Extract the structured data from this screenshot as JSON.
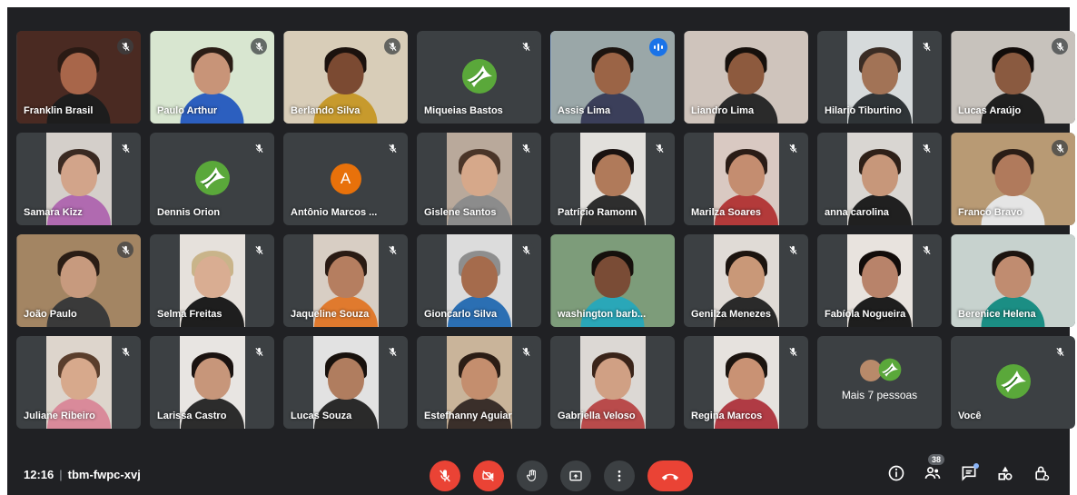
{
  "meeting": {
    "time": "12:16",
    "separator": "|",
    "code": "tbm-fwpc-xvj"
  },
  "participants": [
    {
      "name": "Franklin Brasil",
      "muted": true,
      "style": "photo",
      "bg": "#4a2a22",
      "skin": "#a8664a",
      "shirt": "#1d1d1d",
      "hair": "#2a1a14",
      "wide": true
    },
    {
      "name": "Paulo Arthur",
      "muted": true,
      "style": "photo",
      "bg": "#d8e6d0",
      "skin": "#c89478",
      "shirt": "#2c5fbf",
      "hair": "#2b1d16",
      "wide": true
    },
    {
      "name": "Berlando Silva",
      "muted": true,
      "style": "photo",
      "bg": "#d8cdb8",
      "skin": "#7b4a32",
      "shirt": "#c79a2d",
      "hair": "#1b120e",
      "wide": true
    },
    {
      "name": "Miqueias Bastos",
      "muted": true,
      "style": "logo"
    },
    {
      "name": "Assis Lima",
      "muted": false,
      "speaking": true,
      "style": "photo",
      "bg": "#9aa7a8",
      "skin": "#9b6446",
      "shirt": "#3b3f5a",
      "hair": "#1c1410",
      "wide": true
    },
    {
      "name": "Liandro Lima",
      "muted": false,
      "style": "photo",
      "bg": "#cfc4bc",
      "skin": "#8d5a3e",
      "shirt": "#2a2a2a",
      "hair": "#16100c",
      "wide": true
    },
    {
      "name": "Hilario Tiburtino",
      "muted": true,
      "style": "photo",
      "bg": "#d6dadb",
      "skin": "#a27356",
      "shirt": "#2f3437",
      "hair": "#3a2c24"
    },
    {
      "name": "Lucas Araújo",
      "muted": true,
      "style": "photo",
      "bg": "#c7c2bc",
      "skin": "#8a5a40",
      "shirt": "#1f1f1f",
      "hair": "#120c0a",
      "wide": true
    },
    {
      "name": "Samara Kizz",
      "muted": true,
      "style": "photo",
      "bg": "#d4cfca",
      "skin": "#d2a48a",
      "shirt": "#b06ab0",
      "hair": "#3a2a22"
    },
    {
      "name": "Dennis Orion",
      "muted": true,
      "style": "logo"
    },
    {
      "name": "Antônio Marcos ...",
      "muted": true,
      "style": "letter",
      "letter": "A"
    },
    {
      "name": "Gislene Santos",
      "muted": true,
      "style": "photo",
      "bg": "#b9a99b",
      "skin": "#d6a88a",
      "shirt": "#8c8c8c",
      "hair": "#4a3528"
    },
    {
      "name": "Patrício Ramonn",
      "muted": true,
      "style": "photo",
      "bg": "#e2e0dc",
      "skin": "#b07a5a",
      "shirt": "#2e2e2e",
      "hair": "#1a1210"
    },
    {
      "name": "Marilza Soares",
      "muted": true,
      "style": "photo",
      "bg": "#d9c9c2",
      "skin": "#c48d70",
      "shirt": "#b33a3a",
      "hair": "#2a1c16"
    },
    {
      "name": "anna carolina",
      "muted": true,
      "style": "photo",
      "bg": "#d9d6d2",
      "skin": "#c7977a",
      "shirt": "#202020",
      "hair": "#2e2018"
    },
    {
      "name": "Franco Bravo",
      "muted": true,
      "style": "photo",
      "bg": "#b89a74",
      "skin": "#b07a5c",
      "shirt": "#e5e5e5",
      "hair": "#2a1d16",
      "wide": true
    },
    {
      "name": "João Paulo",
      "muted": true,
      "style": "photo",
      "bg": "#a38563",
      "skin": "#c79a7e",
      "shirt": "#3a3a3a",
      "hair": "#2a1d15",
      "wide": true
    },
    {
      "name": "Selma Freitas",
      "muted": true,
      "style": "photo",
      "bg": "#e6e1dc",
      "skin": "#d9ad92",
      "shirt": "#1e1e1e",
      "hair": "#c9b48a"
    },
    {
      "name": "Jaqueline Souza",
      "muted": true,
      "style": "photo",
      "bg": "#d8cec4",
      "skin": "#b57e60",
      "shirt": "#e07a2e",
      "hair": "#2a1b14"
    },
    {
      "name": "Gioncarlo Silva",
      "muted": true,
      "style": "photo",
      "bg": "#dcdcdc",
      "skin": "#a56b4c",
      "shirt": "#2b6fb3",
      "hair": "#8e8e8e"
    },
    {
      "name": "washington barb...",
      "muted": false,
      "style": "photo",
      "bg": "#7d9c7a",
      "skin": "#7a4c36",
      "shirt": "#2aa7b8",
      "hair": "#15100c",
      "wide": true
    },
    {
      "name": "Genilza Menezes",
      "muted": true,
      "style": "photo",
      "bg": "#e0dbd6",
      "skin": "#c99878",
      "shirt": "#2a2a2a",
      "hair": "#1c140f"
    },
    {
      "name": "Fabíola Nogueira",
      "muted": true,
      "style": "photo",
      "bg": "#e8e3de",
      "skin": "#b8836a",
      "shirt": "#1e1e1e",
      "hair": "#120c0a"
    },
    {
      "name": "Berenice Helena",
      "muted": false,
      "style": "photo",
      "bg": "#c7d2ce",
      "skin": "#c08c70",
      "shirt": "#1b8e84",
      "hair": "#1c140f",
      "wide": true
    },
    {
      "name": "Juliane Ribeiro",
      "muted": true,
      "style": "photo",
      "bg": "#ddd5cc",
      "skin": "#d7a98c",
      "shirt": "#d98a9a",
      "hair": "#5a3e2c"
    },
    {
      "name": "Larissa Castro",
      "muted": true,
      "style": "photo",
      "bg": "#e8e5e2",
      "skin": "#c7967a",
      "shirt": "#2c2c2c",
      "hair": "#1a1210"
    },
    {
      "name": "Lucas Souza",
      "muted": true,
      "style": "photo",
      "bg": "#e2e2e2",
      "skin": "#b07d5f",
      "shirt": "#2a2a2a",
      "hair": "#18110d"
    },
    {
      "name": "Estefhanny Aguiar",
      "muted": true,
      "style": "photo",
      "bg": "#c9b49a",
      "skin": "#c48e6e",
      "shirt": "#3a2f2a",
      "hair": "#2b1d15"
    },
    {
      "name": "Gabriella Veloso",
      "muted": false,
      "style": "photo",
      "bg": "#dcd8d4",
      "skin": "#d0a084",
      "shirt": "#b94b4b",
      "hair": "#3a2419"
    },
    {
      "name": "Regina Marcos",
      "muted": true,
      "style": "photo",
      "bg": "#e6e2de",
      "skin": "#c99274",
      "shirt": "#b03b44",
      "hair": "#1c140f"
    },
    {
      "name": "Mais 7 pessoas",
      "muted": false,
      "style": "more"
    },
    {
      "name": "Você",
      "muted": true,
      "style": "logo"
    }
  ],
  "icons": {
    "mic_off": "mic-off-icon",
    "camera_off": "camera-off-icon",
    "raise_hand": "raise-hand-icon",
    "present": "present-screen-icon",
    "more": "more-options-icon",
    "end_call": "end-call-icon",
    "info": "meeting-details-icon",
    "people": "people-icon",
    "chat": "chat-icon",
    "activities": "activities-icon",
    "host_controls": "host-controls-icon"
  },
  "people_count": "38",
  "colors": {
    "background": "#202124",
    "tile": "#3c4043",
    "accent_blue": "#1a73e8",
    "danger_red": "#ea4335",
    "avatar_orange": "#e8710a",
    "logo_green": "#5aa83a"
  }
}
